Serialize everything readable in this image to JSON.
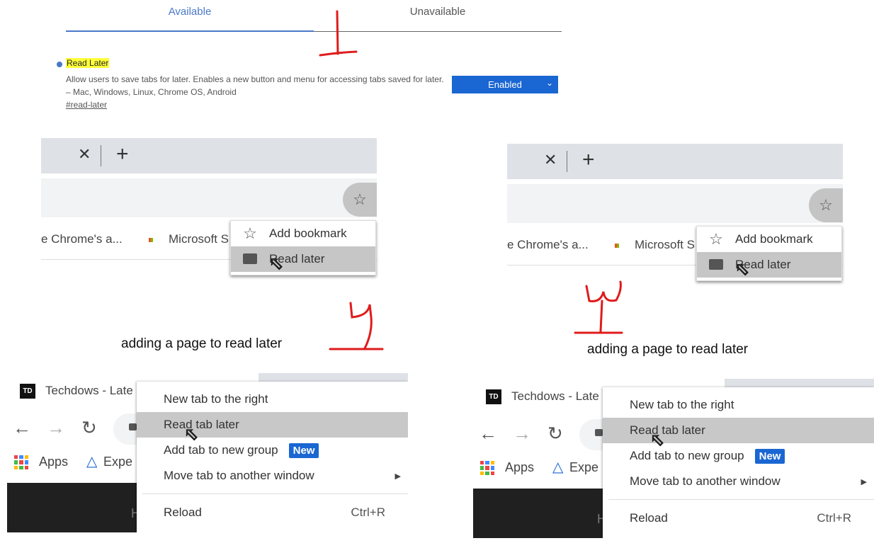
{
  "flags": {
    "tabs": [
      {
        "label": "Available",
        "active": true
      },
      {
        "label": "Unavailable",
        "active": false
      }
    ],
    "flag_title": "Read Later",
    "flag_description": "Allow users to save tabs for later. Enables a new button and menu for accessing tabs saved for later. – Mac, Windows, Linux, Chrome OS, Android",
    "flag_link": "#read-later",
    "select_value": "Enabled",
    "accent": "#1a66d2"
  },
  "bookmark_panels": [
    {
      "bookmarks": [
        "e Chrome's a...",
        "Microsoft S"
      ],
      "menu": [
        {
          "label": "Add bookmark",
          "icon": "star-icon"
        },
        {
          "label": "Read later",
          "icon": "folder-icon",
          "highlighted": true
        }
      ]
    },
    {
      "bookmarks": [
        "e Chrome's a...",
        "Microsoft S"
      ],
      "menu": [
        {
          "label": "Add bookmark",
          "icon": "star-icon"
        },
        {
          "label": "Read later",
          "icon": "folder-icon",
          "highlighted": true
        }
      ]
    }
  ],
  "captions": [
    "adding a page to read later",
    "adding a page to read later"
  ],
  "tab_panels": [
    {
      "favicon": "TD",
      "tab_title": "Techdows - Late",
      "bookmarks": [
        "Apps",
        "Expe"
      ],
      "page_letter": "H",
      "menu": [
        {
          "label": "New tab to the right"
        },
        {
          "label": "Read tab later",
          "highlighted": true
        },
        {
          "label": "Add tab to new group",
          "badge": "New"
        },
        {
          "label": "Move tab to another window",
          "submenu": true
        },
        {
          "label": "Reload",
          "shortcut": "Ctrl+R"
        }
      ]
    },
    {
      "favicon": "TD",
      "tab_title": "Techdows - Late",
      "bookmarks": [
        "Apps",
        "Expe"
      ],
      "page_letter": "H",
      "menu": [
        {
          "label": "New tab to the right"
        },
        {
          "label": "Read tab later",
          "highlighted": true
        },
        {
          "label": "Add tab to new group",
          "badge": "New"
        },
        {
          "label": "Move tab to another window",
          "submenu": true
        },
        {
          "label": "Reload",
          "shortcut": "Ctrl+R"
        }
      ]
    }
  ],
  "annotations": [
    "1",
    "2",
    "3"
  ],
  "annotation_color": "#e01b1b"
}
